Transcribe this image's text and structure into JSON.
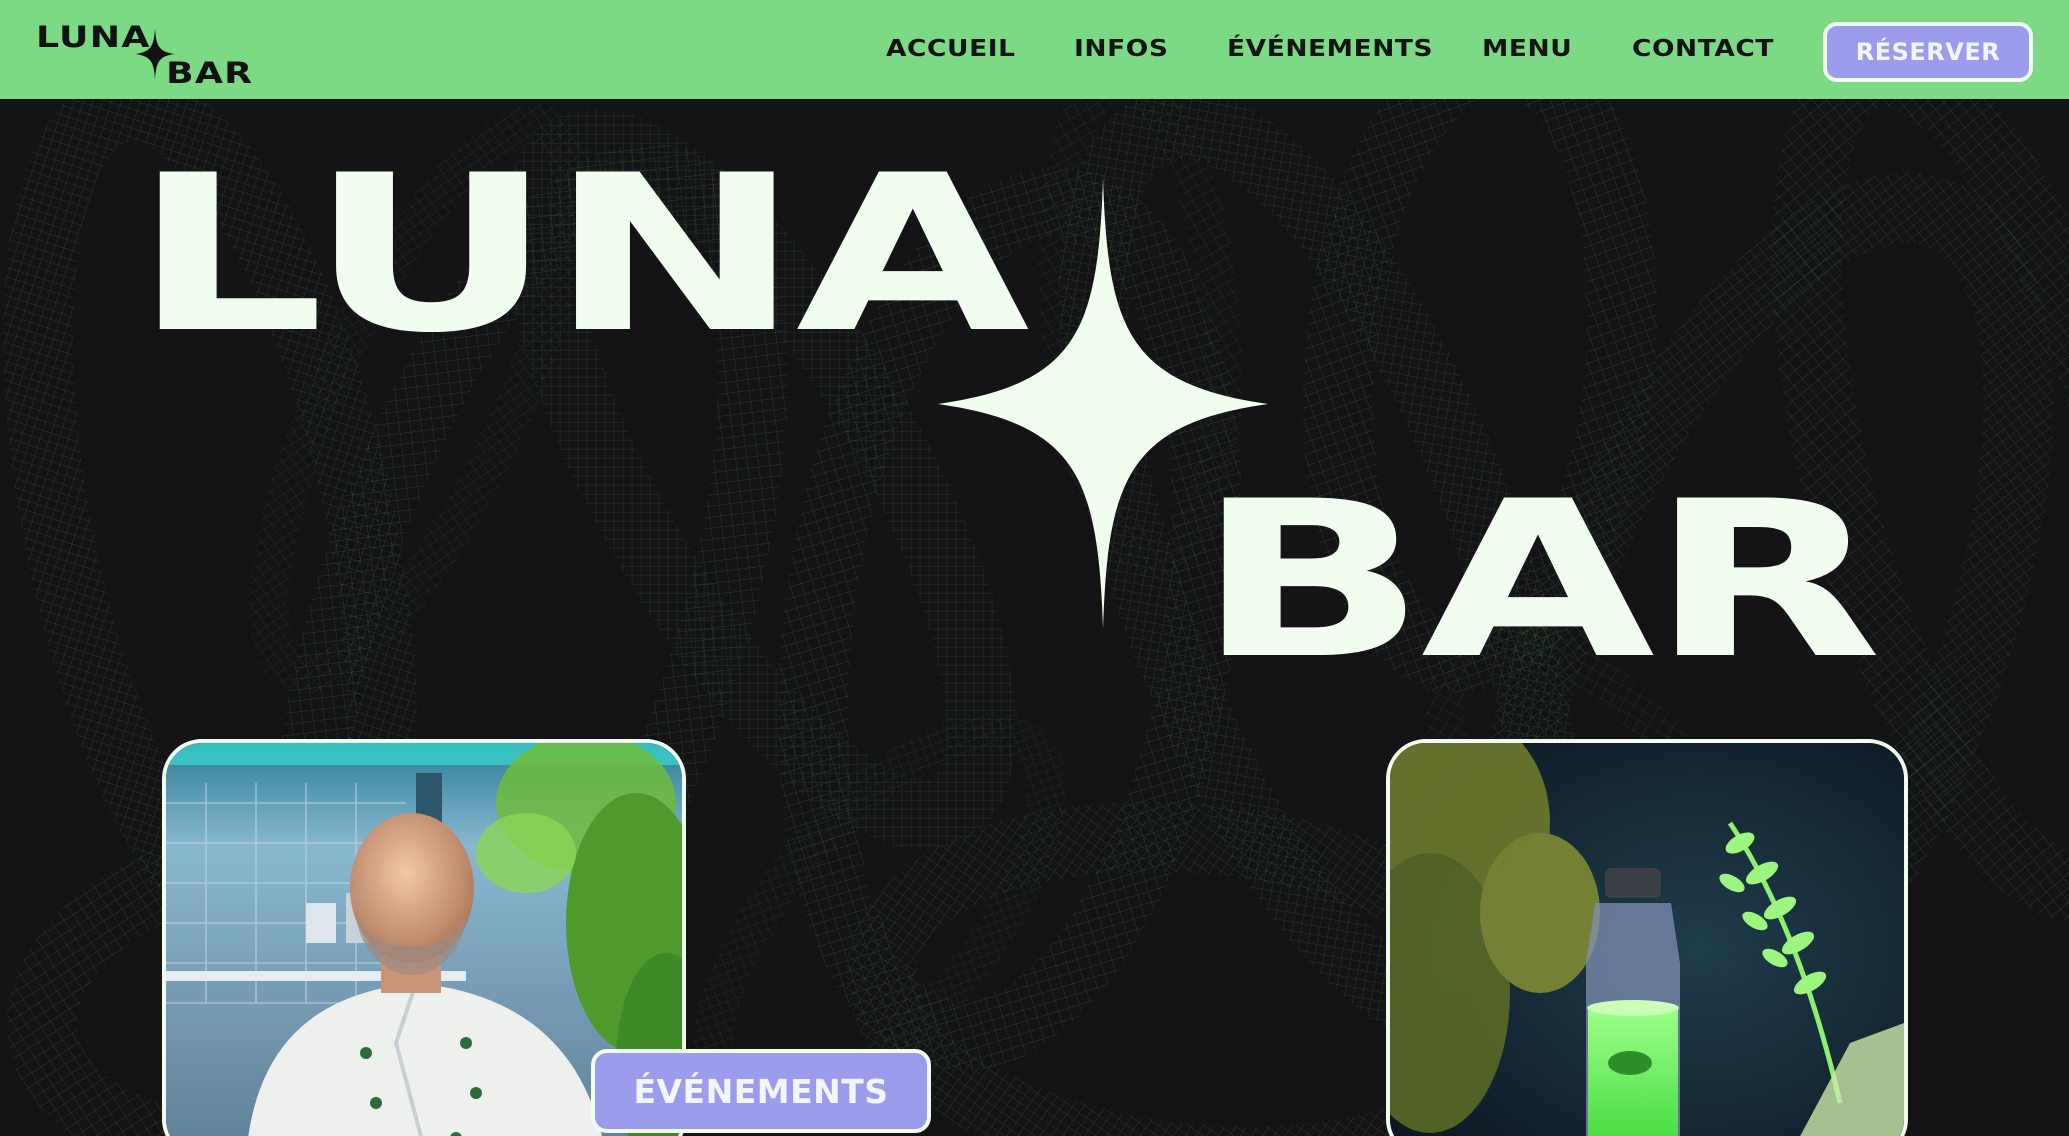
{
  "header": {
    "logo": {
      "line1": "LUNA",
      "line2": "BAR"
    },
    "nav": [
      {
        "label": "ACCUEIL"
      },
      {
        "label": "INFOS"
      },
      {
        "label": "ÉVÉNEMENTS"
      },
      {
        "label": "MENU"
      },
      {
        "label": "CONTACT"
      }
    ],
    "reserve_label": "RÉSERVER"
  },
  "hero": {
    "title_line1": "LUNA",
    "title_line2": "BAR",
    "events_button_label": "ÉVÉNEMENTS",
    "left_card": {
      "subject": "chef-in-kitchen-photo"
    },
    "right_card": {
      "subject": "glowing-bottle-photo"
    }
  },
  "colors": {
    "header_bg": "#7cda84",
    "hero_bg": "#141416",
    "accent_button": "#9c9cec",
    "text_light": "#f1fdef",
    "mesh_green": "#3f8a4a"
  },
  "icons": {
    "logo_star": "four-point-star-icon",
    "hero_star": "four-point-star-icon"
  }
}
